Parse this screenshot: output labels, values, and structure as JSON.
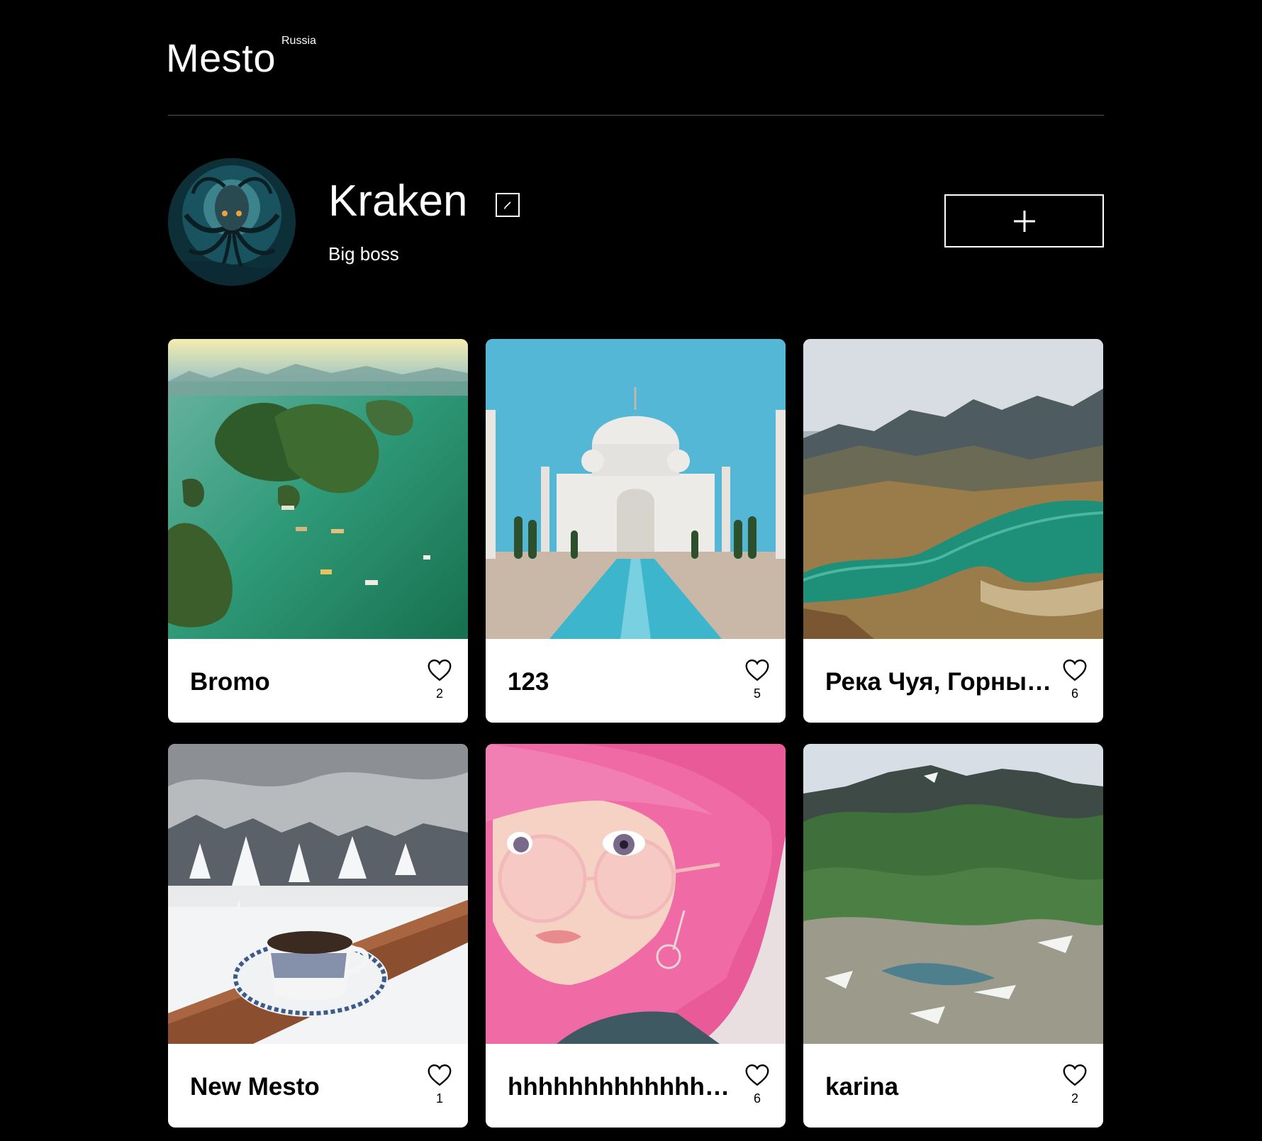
{
  "header": {
    "logo": "Mesto",
    "logo_sup": "Russia"
  },
  "profile": {
    "name": "Kraken",
    "about": "Big boss",
    "edit_icon": "pencil-icon",
    "add_icon": "plus-icon"
  },
  "cards": [
    {
      "title": "Bromo",
      "likes": "2",
      "image": "halong-bay"
    },
    {
      "title": "123",
      "likes": "5",
      "image": "taj-mahal"
    },
    {
      "title": "Река Чуя, Горный Алтай",
      "likes": "6",
      "image": "mountain-river"
    },
    {
      "title": "New Mesto",
      "likes": "1",
      "image": "winter-coffee"
    },
    {
      "title": "hhhhhhhhhhhhhhhhhh",
      "likes": "6",
      "image": "pink-hair-girl"
    },
    {
      "title": "karina",
      "likes": "2",
      "image": "green-mountains"
    }
  ],
  "colors": {
    "background": "#000000",
    "card": "#ffffff",
    "divider": "#545454"
  }
}
